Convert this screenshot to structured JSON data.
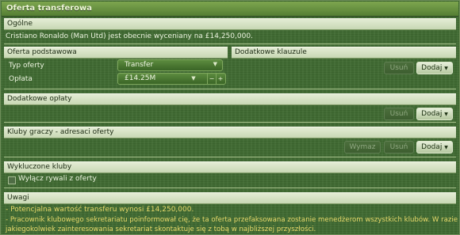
{
  "window": {
    "title": "Oferta transferowa"
  },
  "general": {
    "header": "Ogólne",
    "valuation_text": "Cristiano Ronaldo (Man Utd) jest obecnie wyceniany na £14,250,000."
  },
  "basic_offer": {
    "header": "Oferta podstawowa",
    "type_label": "Typ oferty",
    "type_value": "Transfer",
    "fee_label": "Opłata",
    "fee_value": "£14.25M"
  },
  "additional_clauses": {
    "header": "Dodatkowe klauzule",
    "remove_label": "Usuń",
    "add_label": "Dodaj"
  },
  "additional_fees": {
    "header": "Dodatkowe opłaty",
    "remove_label": "Usuń",
    "add_label": "Dodaj"
  },
  "player_clubs": {
    "header": "Kluby graczy - adresaci oferty",
    "replace_label": "Wymaz",
    "remove_label": "Usuń",
    "add_label": "Dodaj"
  },
  "excluded_clubs": {
    "header": "Wykluczone kluby",
    "checkbox_label": "Wyłącz rywali z oferty"
  },
  "notes": {
    "header": "Uwagi",
    "lines": [
      "- Potencjalna wartość transferu wynosi £14,250,000.",
      "- Pracownik klubowego sekretariatu poinformował cię, że ta oferta przefaksowana zostanie menedżerom wszystkich klubów. W razie",
      "jakiegokolwiek zainteresowania sekretariat skontaktuje się z tobą w najbliższej przyszłości."
    ]
  },
  "colors": {
    "panel_green": "#3f6a31",
    "header_pale": "#e3ecd4",
    "note_yellow": "#e6d86a",
    "title_green": "#7da54f"
  },
  "icons": {
    "dropdown": "chevron-down-icon",
    "decrease": "minus-icon",
    "increase": "plus-icon"
  }
}
